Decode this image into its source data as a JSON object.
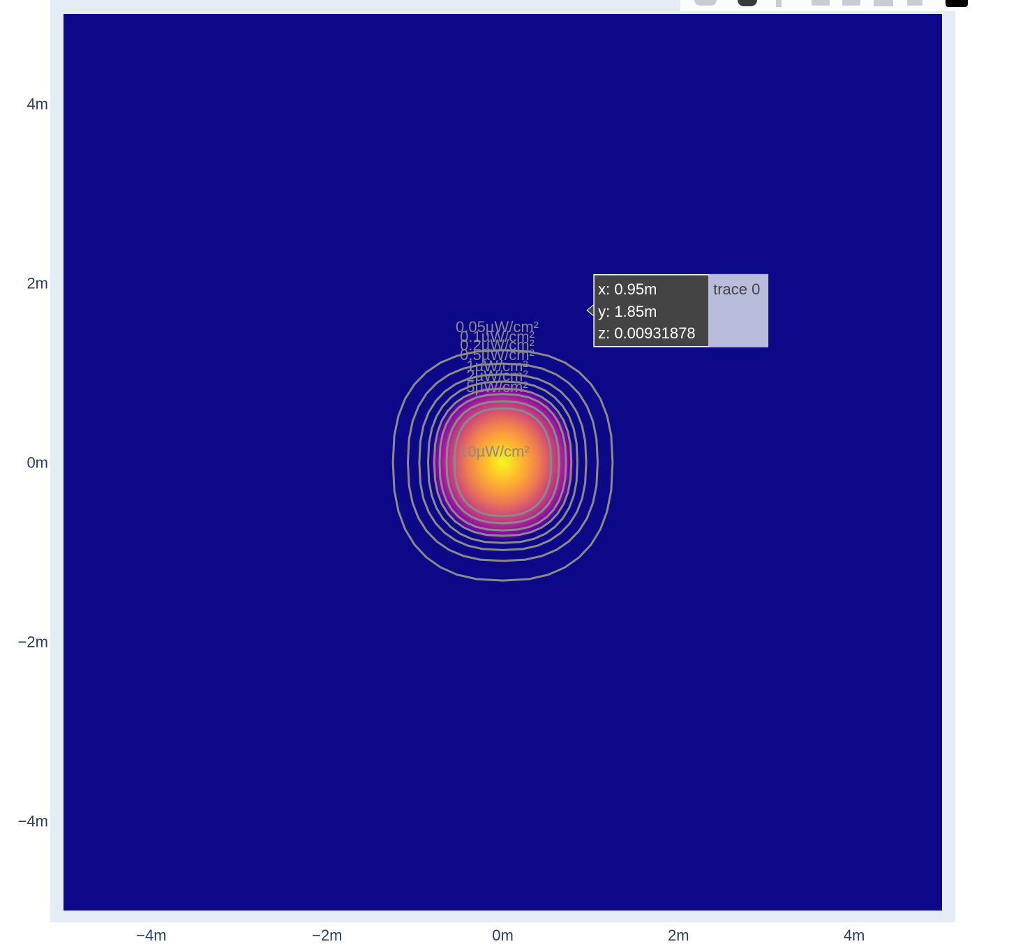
{
  "chart_data": {
    "type": "heatmap",
    "title": "",
    "xlabel": "",
    "ylabel": "",
    "xlim": [
      -5,
      5
    ],
    "ylim": [
      -5,
      5
    ],
    "x_ticks": [
      {
        "value": -4,
        "label": "−4m"
      },
      {
        "value": -2,
        "label": "−2m"
      },
      {
        "value": 0,
        "label": "0m"
      },
      {
        "value": 2,
        "label": "2m"
      },
      {
        "value": 4,
        "label": "4m"
      }
    ],
    "y_ticks": [
      {
        "value": 4,
        "label": "4m"
      },
      {
        "value": 2,
        "label": "2m"
      },
      {
        "value": 0,
        "label": "0m"
      },
      {
        "value": -2,
        "label": "−2m"
      },
      {
        "value": -4,
        "label": "−4m"
      }
    ],
    "colorscale": "plasma",
    "background_color": "#0d0887",
    "heat_center": {
      "x": 0.0,
      "y": 0.0
    },
    "contours": [
      {
        "label": "0.05µW/cm²",
        "rx": 1.25,
        "ry_top": 1.25,
        "ry_bottom": 1.32
      },
      {
        "label": "0.1µW/cm²",
        "rx": 1.08,
        "ry_top": 1.1,
        "ry_bottom": 1.1
      },
      {
        "label": "0.2µW/cm²",
        "rx": 0.95,
        "ry_top": 0.98,
        "ry_bottom": 0.98
      },
      {
        "label": "0.5µW/cm²",
        "rx": 0.85,
        "ry_top": 0.9,
        "ry_bottom": 0.9
      },
      {
        "label": "1µW/cm²",
        "rx": 0.78,
        "ry_top": 0.82,
        "ry_bottom": 0.82
      },
      {
        "label": "2µW/cm²",
        "rx": 0.72,
        "ry_top": 0.76,
        "ry_bottom": 0.76
      },
      {
        "label": "5µW/cm²",
        "rx": 0.64,
        "ry_top": 0.68,
        "ry_bottom": 0.68
      },
      {
        "label": "10µW/cm²",
        "rx": 0.55,
        "ry_top": 0.6,
        "ry_bottom": 0.6
      }
    ],
    "hover": {
      "x_text": "x: 0.95m",
      "y_text": "y: 1.85m",
      "z_text": "z: 0.00931878",
      "trace_name": "trace 0",
      "point": {
        "x": 0.95,
        "y": 1.85
      }
    }
  },
  "colors": {
    "plot_frame": "#e5ecf6",
    "contour_line": "#8a8a8a",
    "tick_text": "#2a3f5f",
    "tooltip_bg": "#444444",
    "tooltip_trace_bg": "#babcdb"
  }
}
